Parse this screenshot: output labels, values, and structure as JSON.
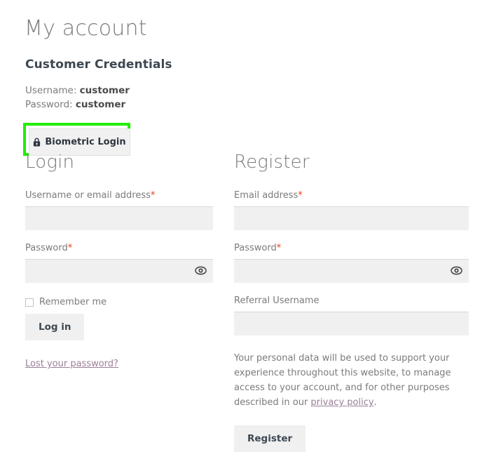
{
  "page": {
    "title": "My account"
  },
  "credentials": {
    "heading": "Customer Credentials",
    "username_label": "Username:",
    "username_value": "customer",
    "password_label": "Password:",
    "password_value": "customer"
  },
  "biometric": {
    "label": "Biometric Login",
    "icon": "lock-icon",
    "highlight_color": "#22ee00"
  },
  "login": {
    "heading": "Login",
    "username_label": "Username or email address",
    "username_required": "*",
    "username_value": "",
    "username_placeholder": "",
    "password_label": "Password",
    "password_required": "*",
    "password_value": "",
    "password_placeholder": "",
    "show_password_icon": "eye-icon",
    "remember_label": "Remember me",
    "remember_checked": false,
    "submit_label": "Log in",
    "lost_password_label": "Lost your password?"
  },
  "register": {
    "heading": "Register",
    "email_label": "Email address",
    "email_required": "*",
    "email_value": "",
    "email_placeholder": "",
    "password_label": "Password",
    "password_required": "*",
    "password_value": "",
    "password_placeholder": "",
    "show_password_icon": "eye-icon",
    "referral_label": "Referral Username",
    "referral_value": "",
    "referral_placeholder": "",
    "privacy_text_part1": "Your personal data will be used to support your experience throughout this website, to manage access to your account, and for other purposes described in our ",
    "privacy_link_label": "privacy policy",
    "privacy_text_part2": ".",
    "submit_label": "Register"
  },
  "colors": {
    "required_asterisk": "#e2401c",
    "link": "#9a7f96",
    "input_bg": "#f0f0f0",
    "button_bg": "#f0f0f0",
    "highlight": "#22ee00"
  }
}
